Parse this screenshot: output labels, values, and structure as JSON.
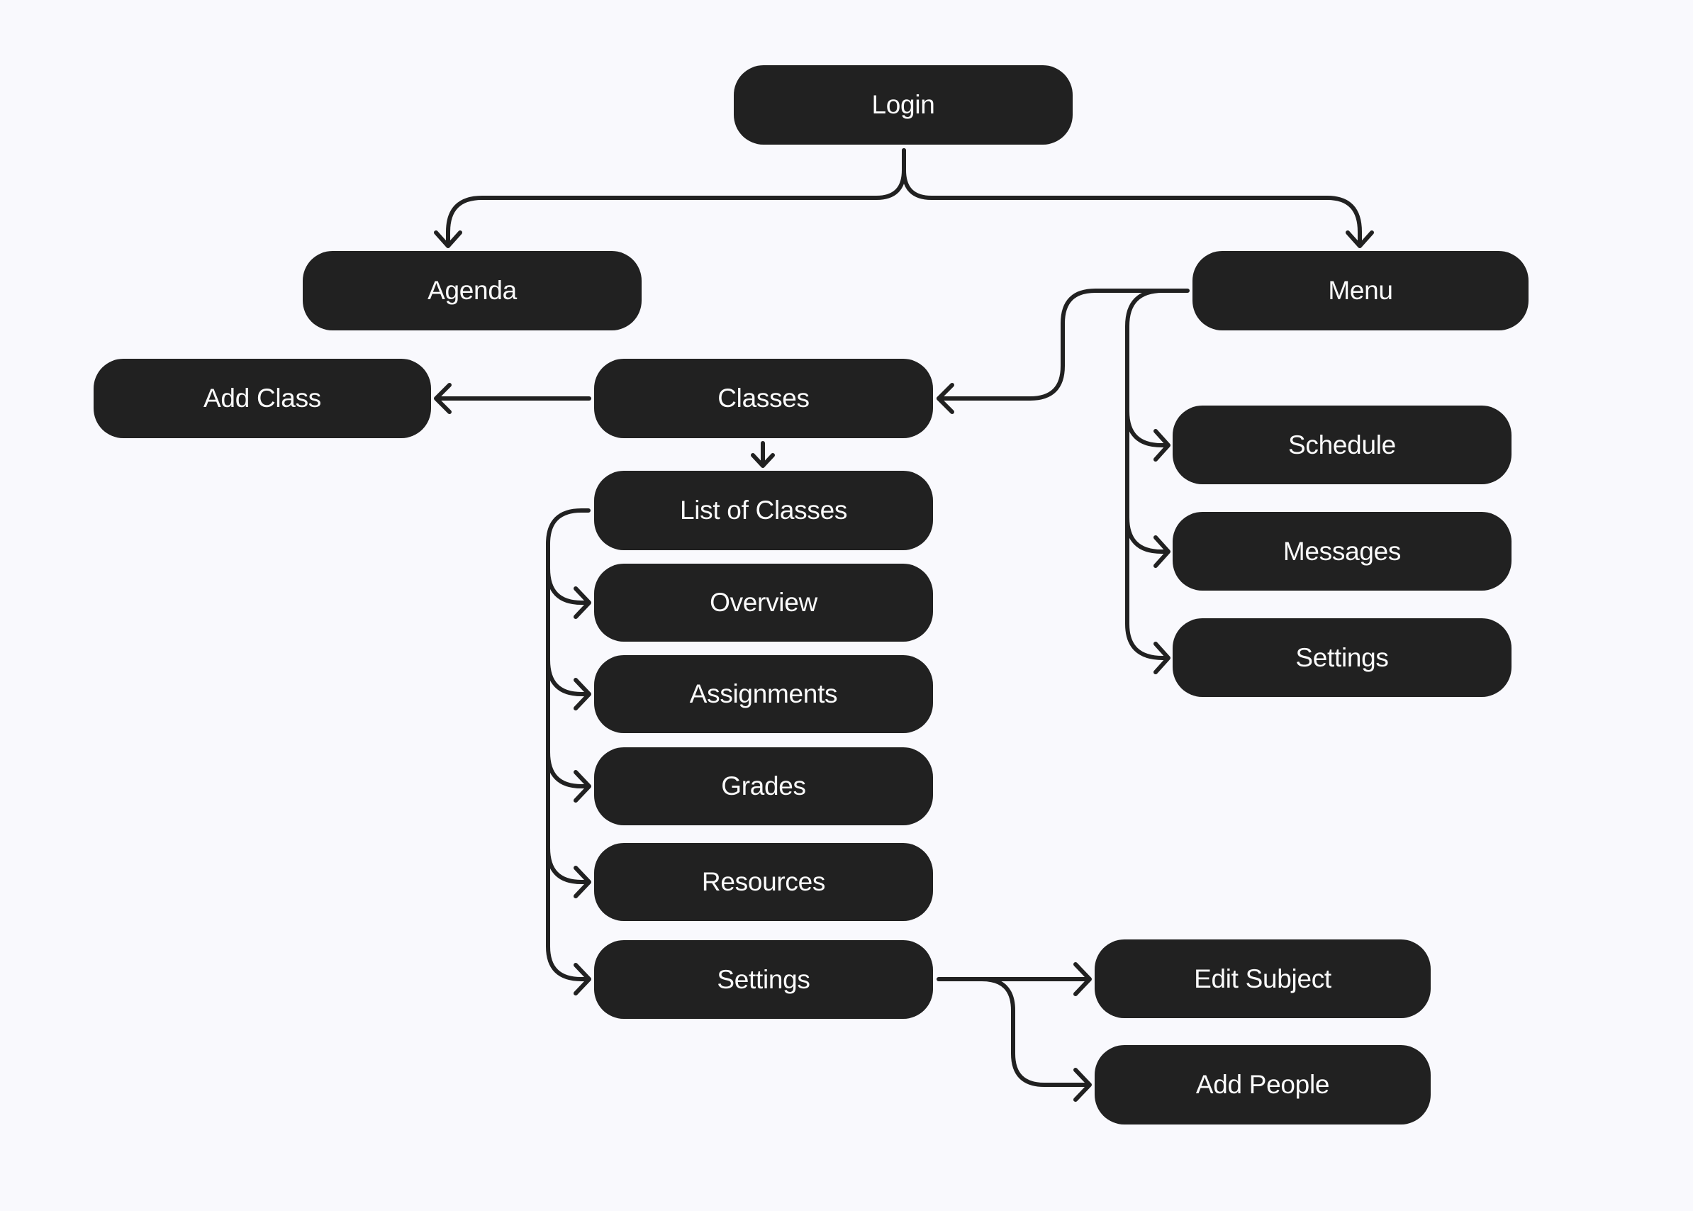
{
  "diagram": {
    "type": "site-map",
    "colors": {
      "background": "#f9f9fd",
      "node": "#212121",
      "text": "#fafafa",
      "connector": "#212121"
    },
    "nodes": {
      "login": "Login",
      "agenda": "Agenda",
      "menu": "Menu",
      "add_class": "Add Class",
      "classes": "Classes",
      "list_of_classes": "List of Classes",
      "overview": "Overview",
      "assignments": "Assignments",
      "grades": "Grades",
      "resources": "Resources",
      "class_settings": "Settings",
      "schedule": "Schedule",
      "messages": "Messages",
      "menu_settings": "Settings",
      "edit_subject": "Edit Subject",
      "add_people": "Add People"
    },
    "edges": [
      [
        "login",
        "agenda"
      ],
      [
        "login",
        "menu"
      ],
      [
        "menu",
        "classes"
      ],
      [
        "menu",
        "schedule"
      ],
      [
        "menu",
        "messages"
      ],
      [
        "menu",
        "menu_settings"
      ],
      [
        "classes",
        "add_class"
      ],
      [
        "classes",
        "list_of_classes"
      ],
      [
        "list_of_classes",
        "overview"
      ],
      [
        "list_of_classes",
        "assignments"
      ],
      [
        "list_of_classes",
        "grades"
      ],
      [
        "list_of_classes",
        "resources"
      ],
      [
        "list_of_classes",
        "class_settings"
      ],
      [
        "class_settings",
        "edit_subject"
      ],
      [
        "class_settings",
        "add_people"
      ]
    ]
  }
}
